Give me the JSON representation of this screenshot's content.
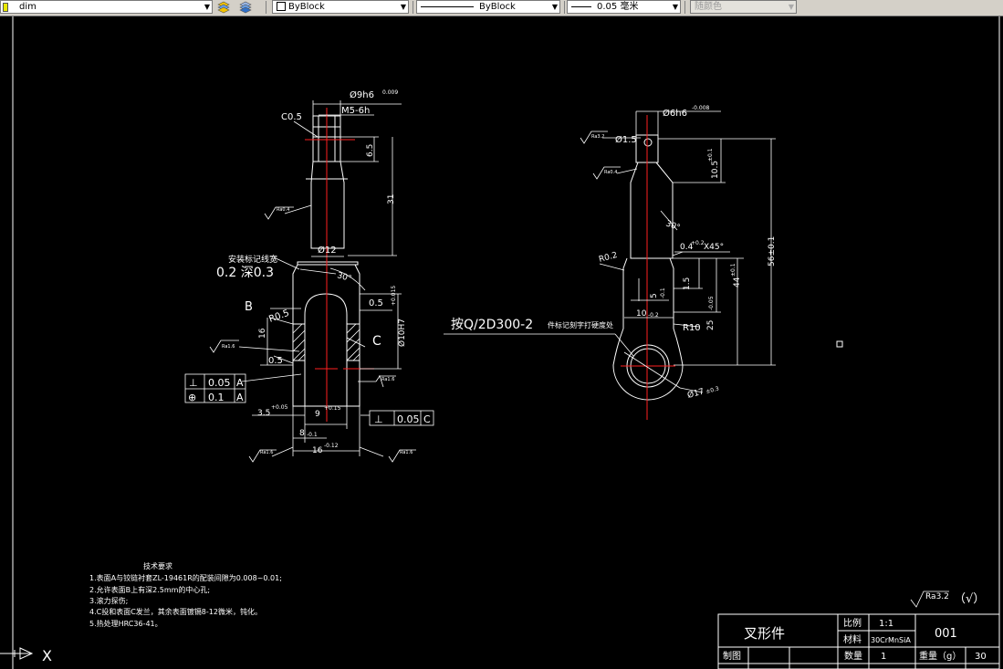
{
  "toolbar": {
    "layer_name": "dim",
    "color": "ByBlock",
    "linetype": "ByBlock",
    "lineweight": "0.05 毫米",
    "plotstyle": "随颜色"
  },
  "left_view": {
    "dim_top_dia": "Ø9h6",
    "dim_top_dia_tol": "0.009",
    "thread": "M5-6h",
    "chamfer": "C0.5",
    "len_65": "6.5",
    "len_31": "31",
    "dia_12": "Ø12",
    "note_mark": "安装标记线宽",
    "note_width": "0.2  深0.3",
    "angle_30": "30°",
    "dim_05_right": "0.5",
    "hole_dia": "Ø10H7",
    "hole_tol": "+0.015",
    "section_b": "B",
    "section_c": "C",
    "r05": "R0.5",
    "len_16": "16",
    "dim_05_mid": "0.5",
    "ra_left": "Ra1.6",
    "ra_right": "Ra1.6",
    "ra_shank": "Ra0.4",
    "ra_bottom_left": "Ra1.6",
    "ra_bottom_right": "Ra1.6",
    "tol_perp_value": "0.05",
    "tol_perp_datum": "A",
    "tol_pos_value": "0.1",
    "tol_pos_datum": "A",
    "tol_c_value": "0.05",
    "tol_c_datum": "C",
    "w35": "3.5",
    "w35_tol": "+0.05",
    "w9": "9",
    "w9_tol": "+0.15",
    "w8": "8",
    "w8_tol": "-0.1",
    "w16": "16",
    "w16_tol": "-0.12",
    "perp_symbol": "⊥",
    "pos_symbol": "⊕"
  },
  "right_view": {
    "dim_top_dia": "Ø6h6",
    "dim_top_dia_tol": "-0.008",
    "hole_15": "Ø1.5",
    "ra_top": "Ra3.2",
    "ra_mid": "Ra0.4",
    "len_105": "10.5",
    "len_105_tol": "±0.1",
    "angle_30": "30°",
    "chamfer_note": "0.4",
    "chamfer_tol": "+0.2",
    "chamfer_angle": "X45°",
    "r02": "R0.2",
    "len_15": "1.5",
    "len_5": "5",
    "len_5_tol": "-0.1",
    "len_10": "10",
    "len_10_tol": "-0.2",
    "len_25": "25",
    "len_25_tol": "-0.05",
    "len_44": "44",
    "len_44_tol": "±0.1",
    "len_56": "56±0.1",
    "r10": "R10",
    "dia_17": "Ø17",
    "dia_17_tol": "±0.3",
    "mark_note": "按Q/2D300-2",
    "mark_note_small": "件标记刻字打硬度处"
  },
  "tech_req": {
    "title": "技术要求",
    "lines": [
      "1.表面A与铰链衬套ZL-19461R的配装间隙为0.008~0.01;",
      "2.允许表面B上有深2.5mm的中心孔;",
      "3.滚力探伤;",
      "4.C投和表面C发兰，其余表面镀镉8-12微米，钝化。",
      "5.热处理HRC36-41。"
    ]
  },
  "roughness_default": {
    "value": "Ra3.2",
    "paren": "（√）"
  },
  "title_block": {
    "part_name": "叉形件",
    "scale_label": "比例",
    "scale_value": "1:1",
    "material_label": "材料",
    "material_value": "30CrMnSiA",
    "drawing_no": "001",
    "drawn_by_label": "制图",
    "qty_label": "数量",
    "qty_value": "1",
    "weight_label": "重量（g）",
    "weight_value": "30"
  },
  "ucs": {
    "x_label": "X"
  },
  "colors": {
    "background": "#000000",
    "lines": "#ffffff",
    "centerline": "#ff0000",
    "toolbar": "#d4d0c8",
    "layer_color": "#e8e800"
  }
}
